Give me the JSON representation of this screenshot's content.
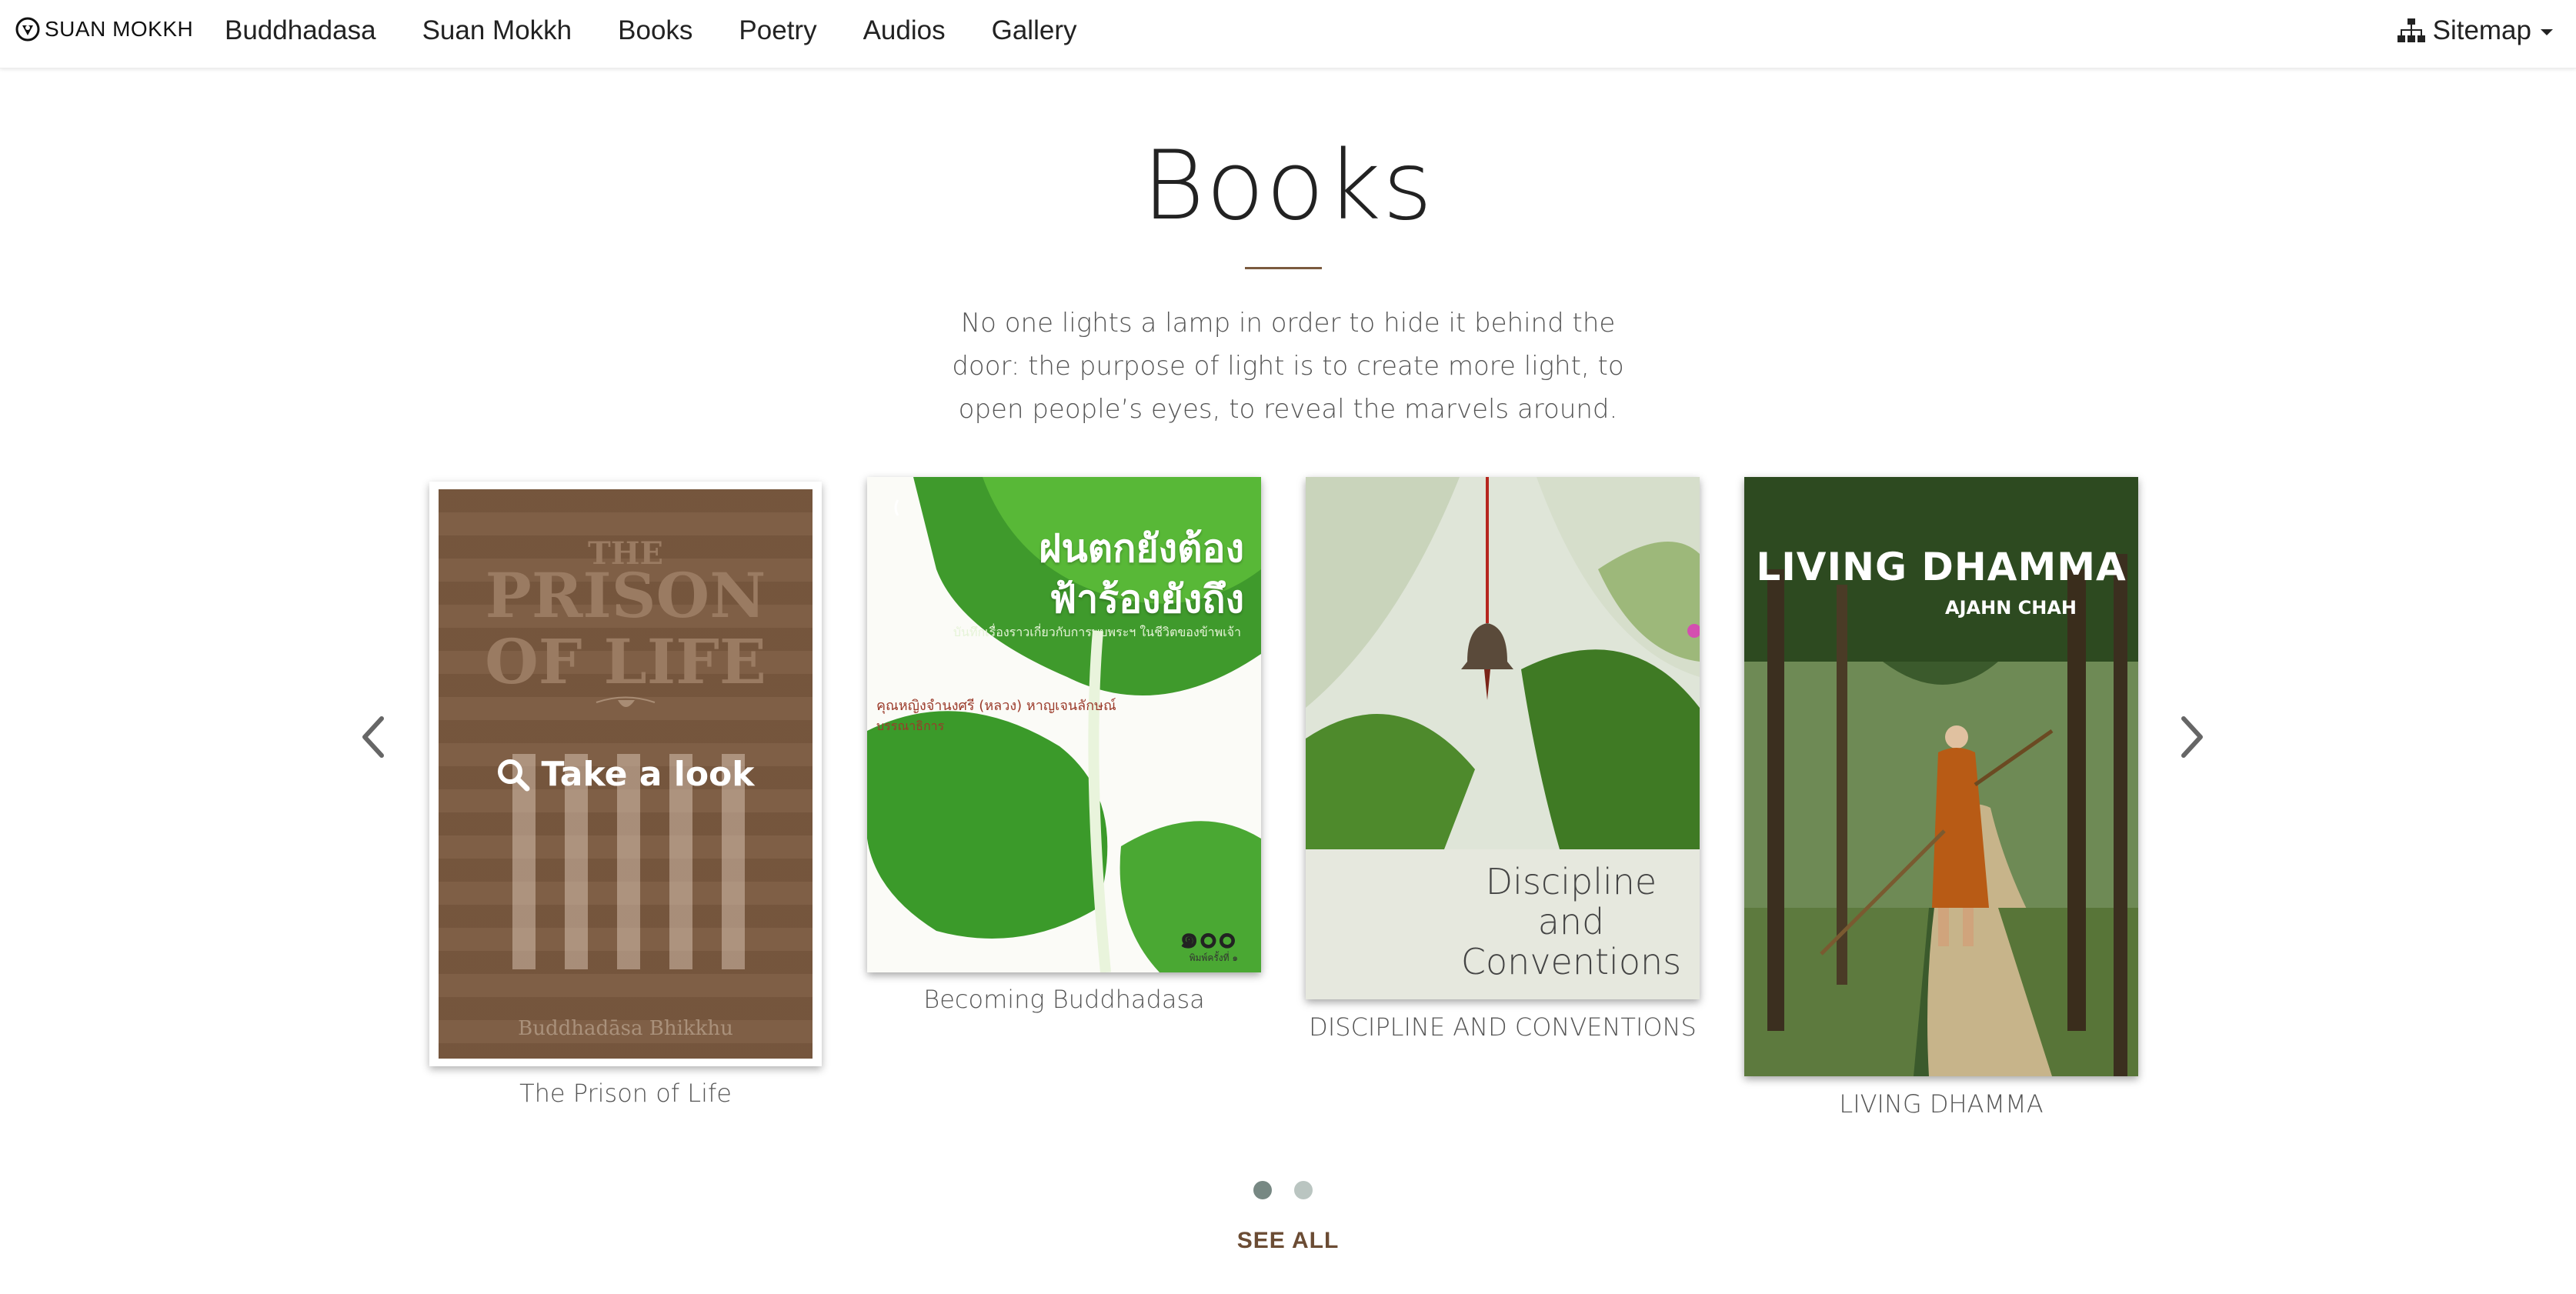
{
  "navbar": {
    "brand": "SUAN MOKKH",
    "links": [
      "Buddhadasa",
      "Suan Mokkh",
      "Books",
      "Poetry",
      "Audios",
      "Gallery"
    ],
    "sitemap": "Sitemap"
  },
  "section": {
    "title": "Books",
    "quote": "No one lights a lamp in order to hide it behind the door: the purpose of light is to create more light, to open people’s eyes, to reveal the marvels around."
  },
  "books": [
    {
      "caption": "The Prison of Life",
      "cover_title_small": "THE",
      "cover_title_big": "PRISON OF LIFE",
      "cover_author": "Buddhadāsa Bhikkhu",
      "hover_label": "Take a look"
    },
    {
      "caption": "Becoming Buddhadasa",
      "cover_title_line1": "ฝนตกยังต้อง",
      "cover_title_line2": "ฟ้าร้องยังถึง",
      "cover_subtitle": "บันทึกเรื่องราวเกี่ยวกับการพบพระฯ ในชีวิตของข้าพเจ้า",
      "cover_byline": "คุณหญิงจำนงศรี (หลวง) หาญเจนลักษณ์",
      "cover_byline2": "บรรณาธิการ",
      "cover_number": "๑๐๐",
      "cover_publisher": "พิมพ์ครั้งที่ ๑"
    },
    {
      "caption": "DISCIPLINE AND CONVENTIONS",
      "cover_title": "Discipline and Conventions"
    },
    {
      "caption": "LIVING DHAMMA",
      "cover_title": "LIVING DHAMMA",
      "cover_author": "AJAHN CHAH"
    }
  ],
  "carousel": {
    "active_page": 1,
    "page_count": 2,
    "see_all": "SEE ALL"
  },
  "colors": {
    "accent_brown": "#6b4c34",
    "divider": "#7b5a3f",
    "dot_active": "#778883",
    "dot_inactive": "#bac5c1"
  }
}
